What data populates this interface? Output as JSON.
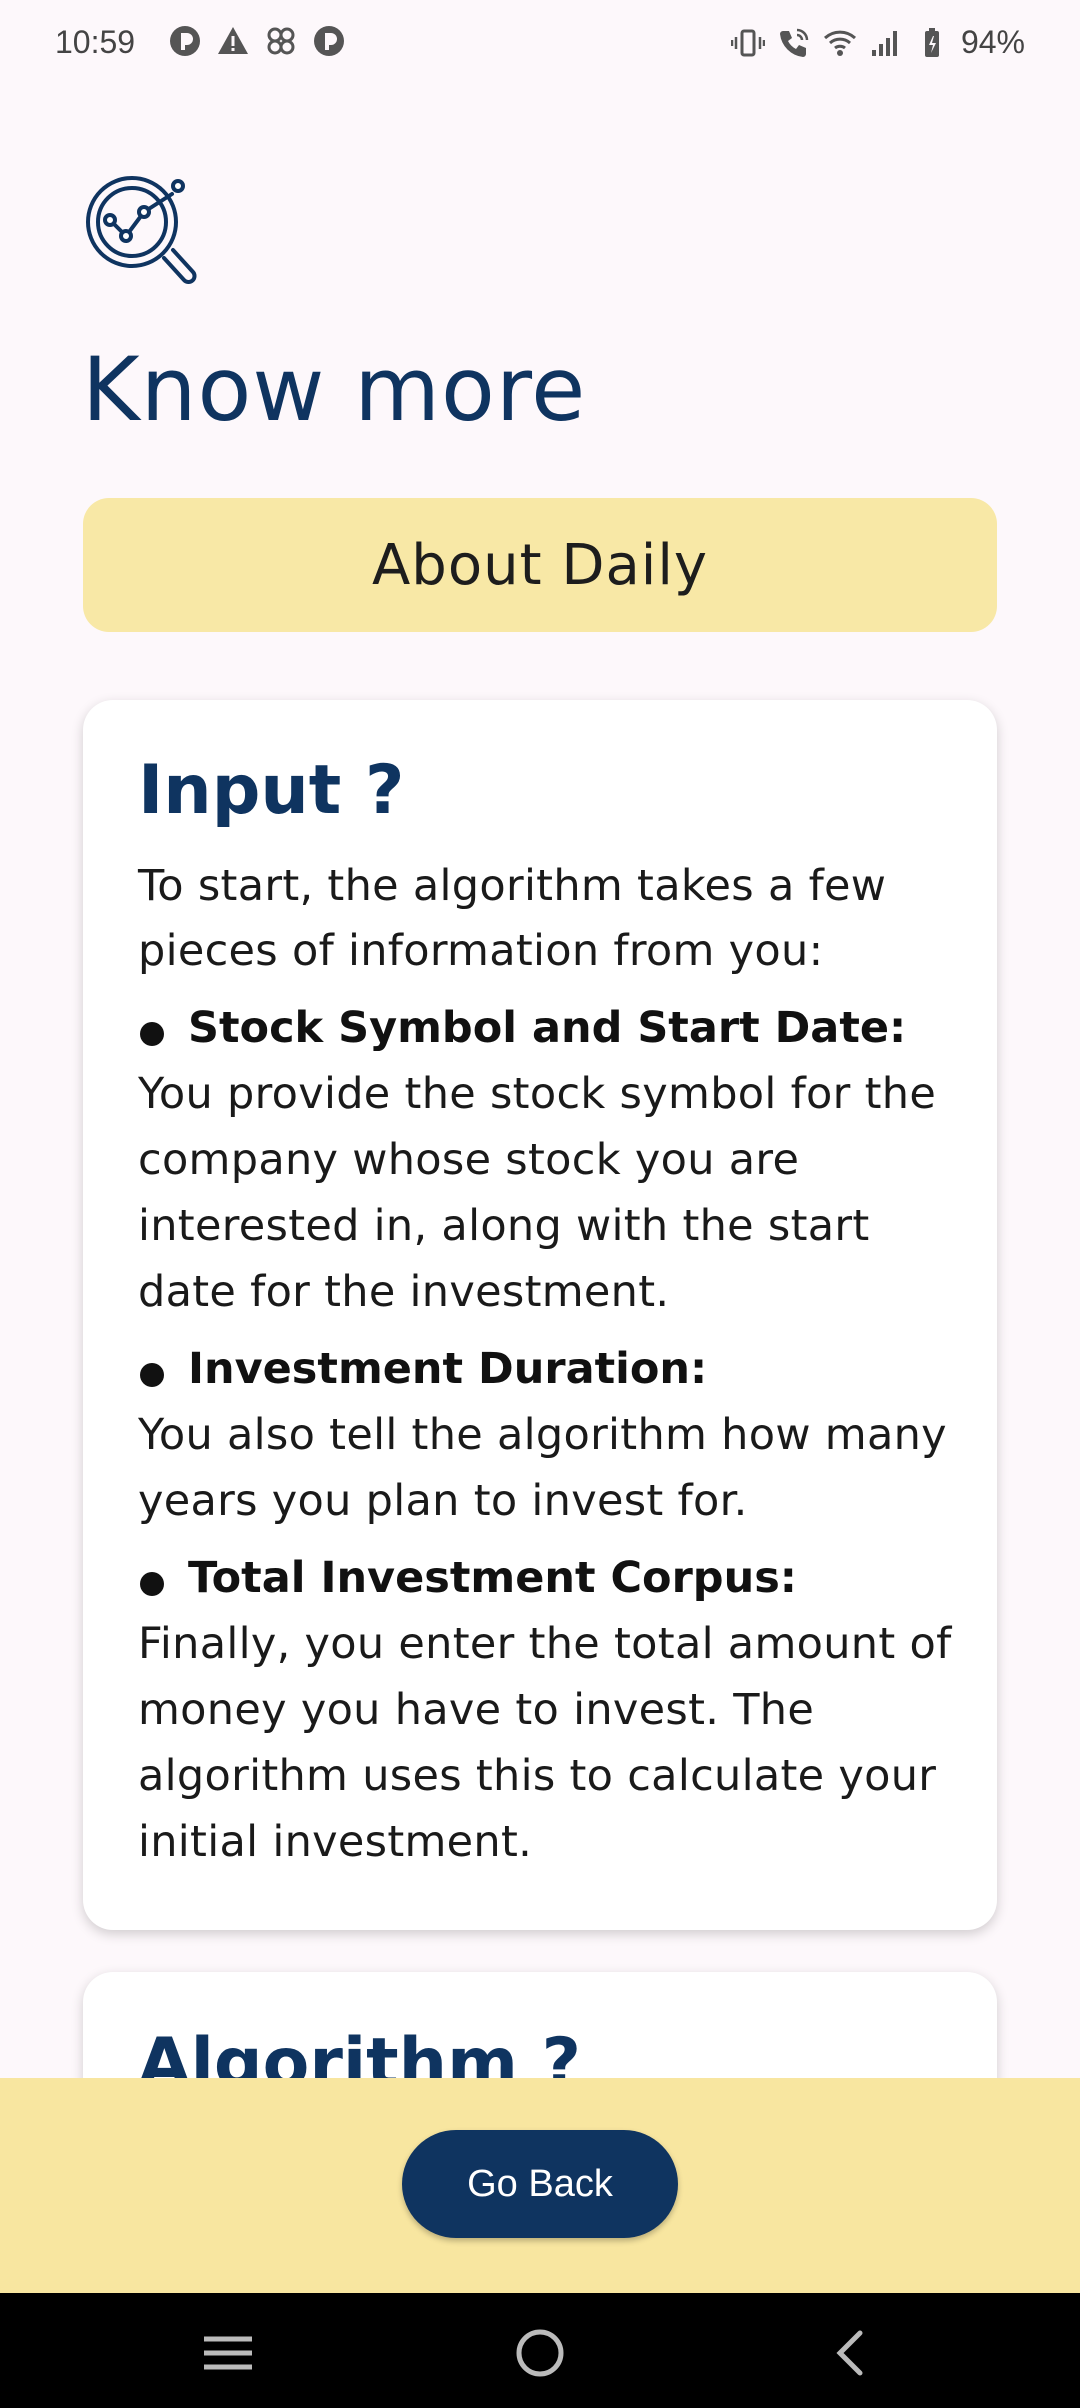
{
  "status_bar": {
    "time": "10:59",
    "battery": "94%",
    "left_icons": [
      "pocket-casts-icon",
      "warning-icon",
      "pinwheel-icon",
      "pocket-casts-icon"
    ],
    "right_icons": [
      "vibrate-icon",
      "wifi-calling-icon",
      "wifi-icon",
      "signal-icon",
      "battery-icon"
    ]
  },
  "header": {
    "icon": "chart-magnifier-icon",
    "title": "Know more"
  },
  "banner": {
    "label": "About Daily"
  },
  "input_card": {
    "heading": "Input ?",
    "intro": "To start, the algorithm takes a few pieces of information from you:",
    "bullets": [
      {
        "title": "Stock Symbol and Start Date:",
        "desc": "You provide the stock symbol for the company whose stock you are interested in, along with the start date for the investment."
      },
      {
        "title": "Investment Duration:",
        "desc": "You also tell the algorithm how many years you plan to invest for."
      },
      {
        "title": "Total Investment Corpus:",
        "desc": "Finally, you enter the total amount of money you have to invest. The algorithm uses this to calculate your initial investment."
      }
    ]
  },
  "algorithm_card": {
    "heading": "Algorithm ?"
  },
  "footer": {
    "go_back_label": "Go Back"
  },
  "colors": {
    "primary": "#0f3460",
    "accent_yellow": "#f8e8a6",
    "background": "#fdf8fb"
  }
}
